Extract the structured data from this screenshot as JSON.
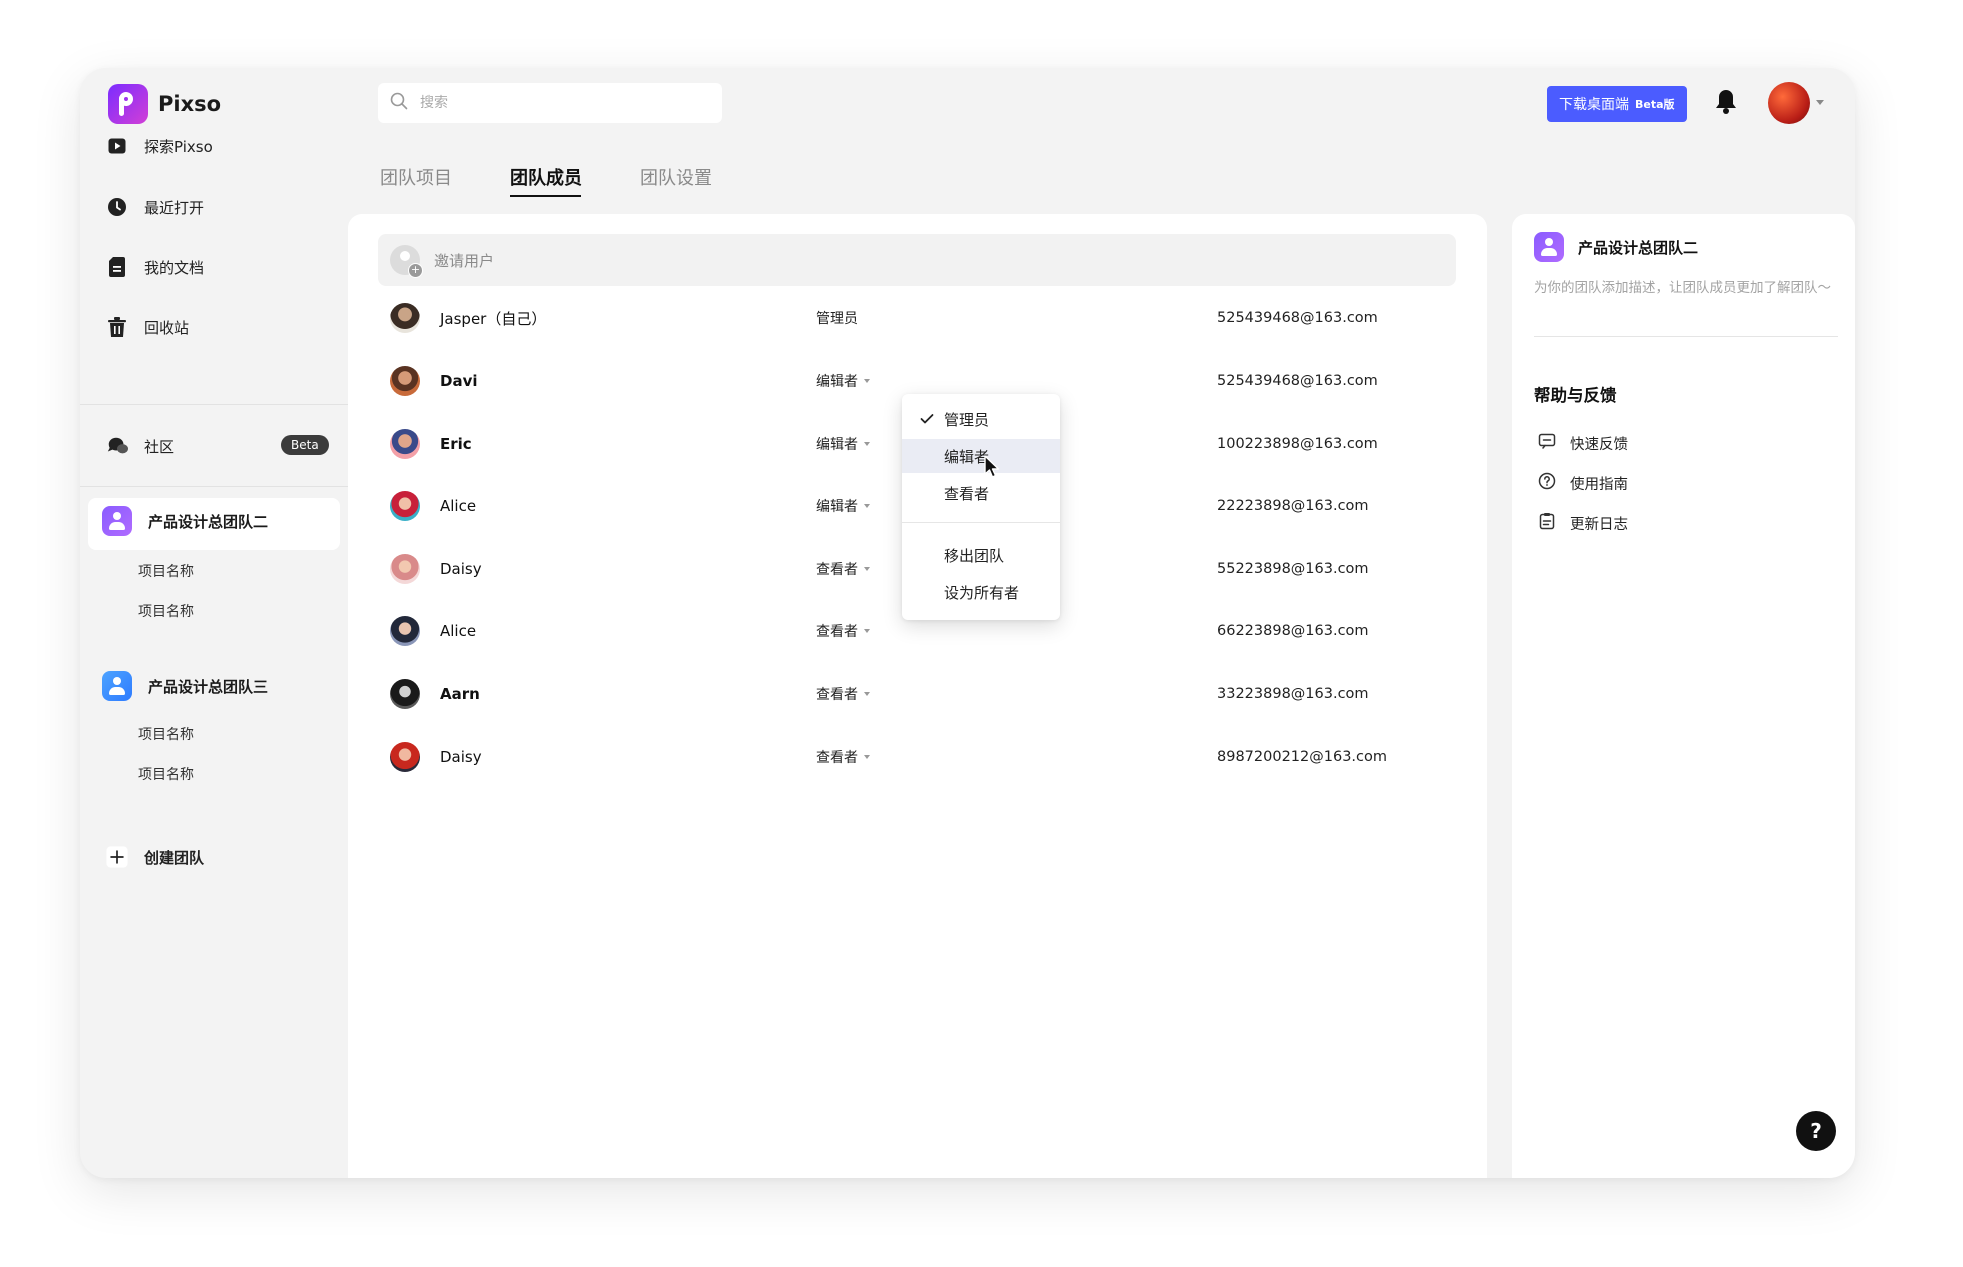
{
  "app": {
    "name": "Pixso"
  },
  "search": {
    "placeholder": "搜索"
  },
  "topbar": {
    "download_label": "下载桌面端",
    "download_beta": "Beta版"
  },
  "sidebar": {
    "items": [
      {
        "label": "探索Pixso",
        "icon": "play-icon"
      },
      {
        "label": "最近打开",
        "icon": "clock-icon"
      },
      {
        "label": "我的文档",
        "icon": "document-icon"
      },
      {
        "label": "回收站",
        "icon": "trash-icon"
      }
    ],
    "community": {
      "label": "社区",
      "badge": "Beta",
      "icon": "chat-bubble-icon"
    },
    "teams": [
      {
        "name": "产品设计总团队二",
        "projects": [
          "项目名称",
          "项目名称"
        ],
        "icon": "team-avatar-icon",
        "color": "#8a5cff"
      },
      {
        "name": "产品设计总团队三",
        "projects": [
          "项目名称",
          "项目名称"
        ],
        "icon": "team-avatar-icon",
        "color": "#3b8cff"
      }
    ],
    "create_team": "创建团队"
  },
  "tabs": [
    {
      "label": "团队项目",
      "active": false
    },
    {
      "label": "团队成员",
      "active": true
    },
    {
      "label": "团队设置",
      "active": false
    }
  ],
  "invite": {
    "label": "邀请用户"
  },
  "members": [
    {
      "name": "Jasper（自己）",
      "role": "管理员",
      "email": "525439468@163.com",
      "has_dropdown": false
    },
    {
      "name": "Davi",
      "role": "编辑者",
      "email": "525439468@163.com",
      "has_dropdown": true
    },
    {
      "name": "Eric",
      "role": "编辑者",
      "email": "100223898@163.com",
      "has_dropdown": true
    },
    {
      "name": "Alice",
      "role": "编辑者",
      "email": "22223898@163.com",
      "has_dropdown": true
    },
    {
      "name": "Daisy",
      "role": "查看者",
      "email": "55223898@163.com",
      "has_dropdown": true
    },
    {
      "name": "Alice",
      "role": "查看者",
      "email": "66223898@163.com",
      "has_dropdown": true
    },
    {
      "name": "Aarn",
      "role": "查看者",
      "email": "33223898@163.com",
      "has_dropdown": true
    },
    {
      "name": "Daisy",
      "role": "查看者",
      "email": "8987200212@163.com",
      "has_dropdown": true
    }
  ],
  "role_dropdown": {
    "options": [
      "管理员",
      "编辑者",
      "查看者"
    ],
    "checked": "管理员",
    "hovered": "编辑者",
    "actions": [
      "移出团队",
      "设为所有者"
    ]
  },
  "right_panel": {
    "team_name": "产品设计总团队二",
    "description_placeholder": "为你的团队添加描述，让团队成员更加了解团队～",
    "help_title": "帮助与反馈",
    "links": [
      {
        "label": "快速反馈",
        "icon": "feedback-icon"
      },
      {
        "label": "使用指南",
        "icon": "question-circle-icon"
      },
      {
        "label": "更新日志",
        "icon": "clipboard-icon"
      }
    ]
  },
  "help_button": {
    "label": "?"
  },
  "colors": {
    "accent": "#4b5cff",
    "brand_gradient_start": "#7b2cff",
    "brand_gradient_end": "#d23fd6"
  }
}
